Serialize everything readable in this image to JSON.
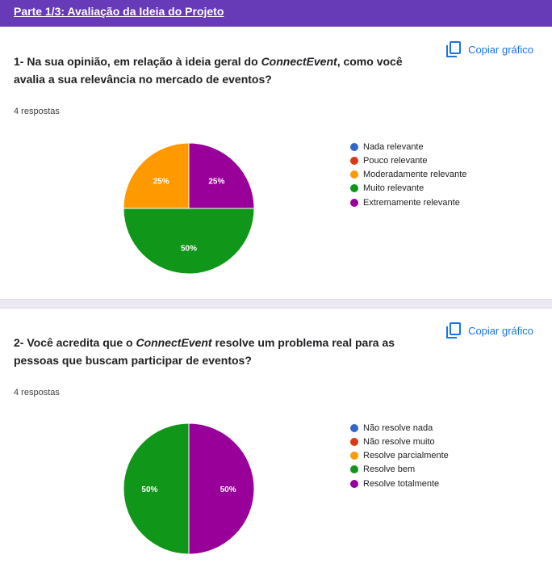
{
  "section": {
    "title": "Parte 1/3: Avaliação da Ideia do Projeto"
  },
  "copy_label": "Copiar gráfico",
  "questions": [
    {
      "title_prefix": "1- Na sua opinião, em relação à ideia geral do ",
      "title_italic": "ConnectEvent",
      "title_suffix": ", como você avalia a sua relevância no mercado de eventos?",
      "responses": "4 respostas"
    },
    {
      "title_prefix": "2- Você acredita que o ",
      "title_italic": "ConnectEvent",
      "title_suffix": " resolve um problema real para as pessoas que buscam participar de eventos?",
      "responses": "4 respostas"
    }
  ],
  "chart_data": [
    {
      "type": "pie",
      "categories": [
        "Nada relevante",
        "Pouco relevante",
        "Moderadamente relevante",
        "Muito relevante",
        "Extremamente relevante"
      ],
      "values": [
        0,
        0,
        25,
        50,
        25
      ],
      "data_labels": [
        "",
        "",
        "25%",
        "50%",
        "25%"
      ],
      "colors": [
        "#3366cc",
        "#dc3912",
        "#ff9900",
        "#109618",
        "#990099"
      ],
      "legend": "right"
    },
    {
      "type": "pie",
      "categories": [
        "Não resolve nada",
        "Não resolve muito",
        "Resolve parcialmente",
        "Resolve bem",
        "Resolve totalmente"
      ],
      "values": [
        0,
        0,
        0,
        50,
        50
      ],
      "data_labels": [
        "",
        "",
        "",
        "50%",
        "50%"
      ],
      "colors": [
        "#3366cc",
        "#dc3912",
        "#ff9900",
        "#109618",
        "#990099"
      ],
      "legend": "right"
    }
  ]
}
